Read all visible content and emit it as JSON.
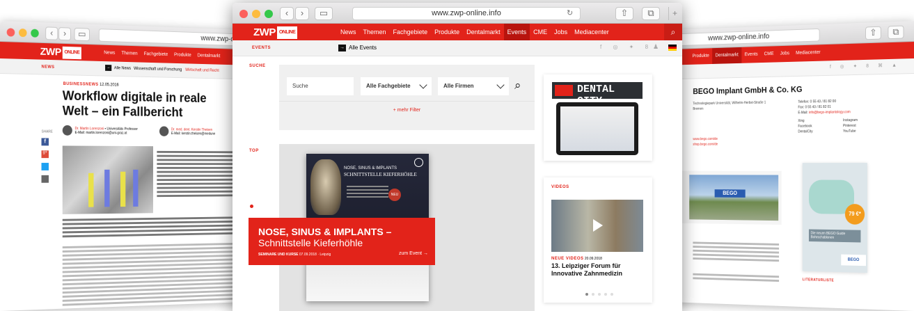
{
  "left": {
    "url": "www.zwp-online.info",
    "logo": "ZWP",
    "logo_badge": "ONLINE",
    "nav": [
      "News",
      "Themen",
      "Fachgebiete",
      "Produkte",
      "Dentalmarkt"
    ],
    "section": "NEWS",
    "subnav": [
      "Alle News",
      "Wissenschaft und Forschung",
      "Wirtschaft und Recht"
    ],
    "kicker": "BUSINESSNEWS",
    "date": "12.05.2016",
    "headline": "Workflow digitale in reale Welt – ein Fallbericht",
    "share": "SHARE",
    "author1_name": "Dr. Martin Lorenzoni",
    "author1_role": " • Universitäts Professor",
    "author1_mail": "E-Mail: martin.lorenzoni@uni-graz.at",
    "author2_name": "Dr. med. dent. Kerstin Theisen",
    "author2_mail": "E-Mail: kerstin.theisen@medune"
  },
  "center": {
    "url": "www.zwp-online.info",
    "logo": "ZWP",
    "logo_badge": "ONLINE",
    "nav": [
      "News",
      "Themen",
      "Fachgebiete",
      "Produkte",
      "Dentalmarkt",
      "Events",
      "CME",
      "Jobs",
      "Mediacenter"
    ],
    "active_nav": "Events",
    "section": "EVENTS",
    "all_events": "Alle Events",
    "search_label": "SUCHE",
    "search_placeholder": "Suche",
    "filter1": "Alle Fachgebiete",
    "filter2": "Alle Firmen",
    "more_filter": "+  mehr Filter",
    "top_label": "TOP",
    "event_title1": "NOSE, SINUS & IMPLANTS –",
    "event_title2": "Schnittstelle Kieferhöhle",
    "event_meta_kind": "SEMINARE UND KURSE",
    "event_meta_date": "07.09.2018 · Leipzig",
    "event_link": "zum Event  →",
    "flyer_line1": "NOSE, SINUS & IMPLANTS",
    "flyer_line2": "SCHNITTSTELLE KIEFERHÖHLE",
    "flyer_badge": "NEU",
    "dental_city": "DENTAL CITY",
    "videos_label": "VIDEOS",
    "video_kicker": "NEUE VIDEOS",
    "video_date": "20.09.2018",
    "video_title": "13. Leipziger Forum für Innovative Zahnmedizin"
  },
  "right": {
    "url": "www.zwp-online.info",
    "nav": [
      "Produkte",
      "Dentalmarkt",
      "Events",
      "CME",
      "Jobs",
      "Mediacenter"
    ],
    "company": "BEGO Implant GmbH & Co. KG",
    "address1": "Technologiepark Universität, Wilhelm-Herbst-Straße 1",
    "address2": "Bremen",
    "phone_label": "Telefon:",
    "phone": "0 55 43 / 81 82 00",
    "fax_label": "Fax:",
    "fax": "0 55 43 / 81 82 01",
    "email_label": "E-Mail:",
    "email": "info@bego-implantology.com",
    "website": "www.bego.com/de",
    "shop": "shop.bego.com/de",
    "social": [
      "Xing",
      "Instagram",
      "Facebook",
      "Pinterest",
      "DentalCity",
      "YouTube"
    ],
    "bego": "BEGO",
    "price": "79 €*",
    "flyer_title": "Die neuen BEGO Guide Bohrschablonen",
    "literature": "LITERATURLISTE"
  }
}
